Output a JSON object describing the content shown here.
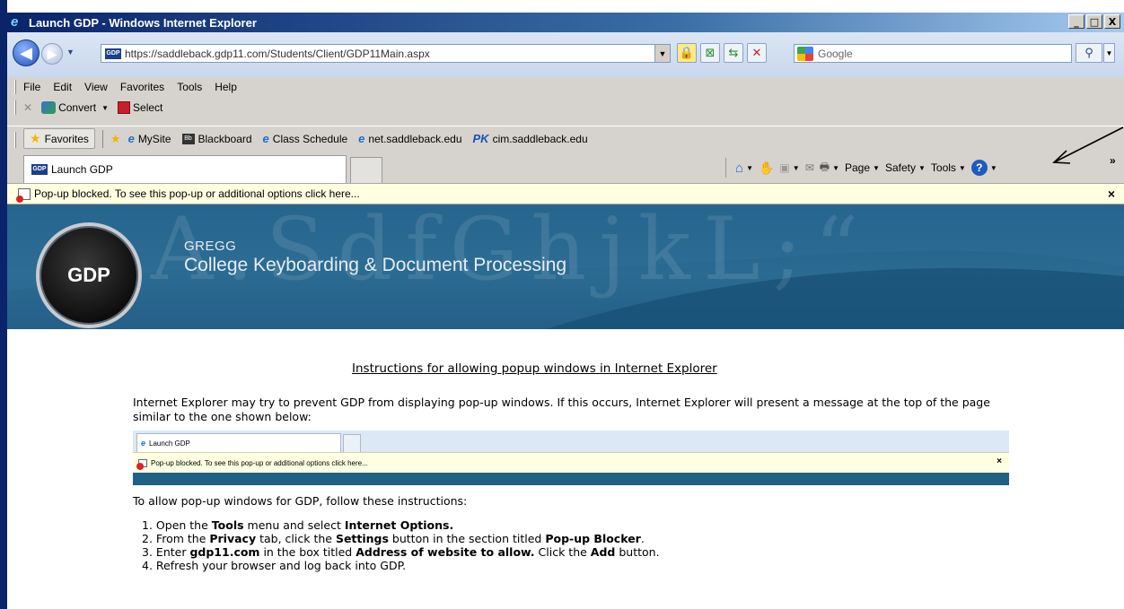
{
  "window": {
    "title": "Launch GDP - Windows Internet Explorer",
    "minimize": "_",
    "maximize": "□",
    "close": "X"
  },
  "address": {
    "url": "https://saddleback.gdp11.com/Students/Client/GDP11Main.aspx",
    "favicon_text": "GDP",
    "search_placeholder": "Google"
  },
  "menu": [
    "File",
    "Edit",
    "View",
    "Favorites",
    "Tools",
    "Help"
  ],
  "convert_bar": {
    "convert_label": "Convert",
    "select_label": "Select"
  },
  "favorites_bar": {
    "favorites_label": "Favorites",
    "links": [
      {
        "label": "MySite",
        "icon": "ie-e-icon"
      },
      {
        "label": "Blackboard",
        "icon": "blackboard-icon"
      },
      {
        "label": "Class Schedule",
        "icon": "ie-e-icon"
      },
      {
        "label": "net.saddleback.edu",
        "icon": "ie-e-icon"
      },
      {
        "label": "cim.saddleback.edu",
        "icon": "pk-icon"
      }
    ]
  },
  "tab": {
    "title": "Launch GDP"
  },
  "command_bar": {
    "page": "Page",
    "safety": "Safety",
    "tools": "Tools",
    "more": "»"
  },
  "infobar": {
    "message": "Pop-up blocked. To see this pop-up or additional options click here...",
    "close": "×"
  },
  "banner": {
    "logo": "GDP",
    "brand_small": "GREGG",
    "brand_large": "College Keyboarding & Document Processing",
    "watermark": "A.SdfGhjkL;“"
  },
  "content": {
    "title": "Instructions for allowing popup windows in Internet Explorer",
    "intro": "Internet Explorer may try to prevent GDP from displaying pop-up windows. If this occurs, Internet Explorer will present a message at the top of the page similar to the one shown below:",
    "example_tab": "Launch GDP",
    "example_infobar": "Pop-up blocked. To see this pop-up or additional options click here...",
    "example_close": "×",
    "allow_line": "To allow pop-up windows for GDP, follow these instructions:",
    "steps": [
      {
        "num": "1.",
        "parts": [
          "Open the ",
          "Tools",
          " menu and select ",
          "Internet Options.",
          ""
        ]
      },
      {
        "num": "2.",
        "parts": [
          "From the ",
          "Privacy",
          " tab, click the ",
          "Settings",
          " button in the section titled ",
          "Pop-up Blocker",
          "."
        ]
      },
      {
        "num": "3.",
        "parts": [
          "Enter ",
          "gdp11.com",
          " in the box titled ",
          "Address of website to allow.",
          " Click the ",
          "Add",
          " button."
        ]
      },
      {
        "num": "4.",
        "parts": [
          "Refresh your browser and log back into GDP."
        ]
      }
    ]
  }
}
